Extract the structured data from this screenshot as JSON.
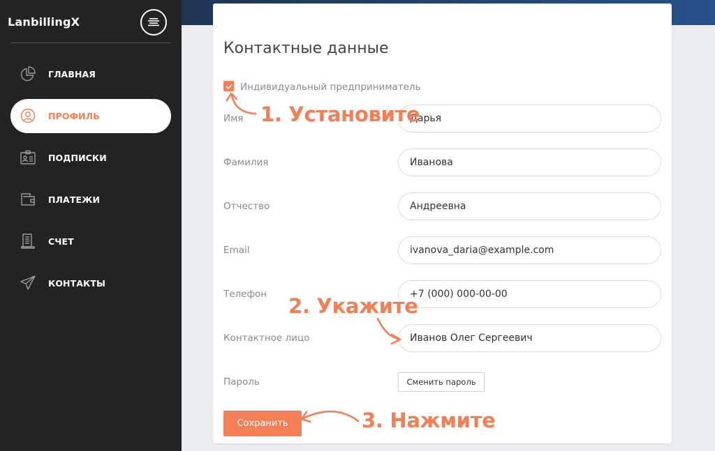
{
  "app": {
    "brand": "LanbillingX"
  },
  "sidebar": {
    "items": [
      {
        "label": "ГЛАВНАЯ",
        "icon": "pie-chart-icon",
        "active": false
      },
      {
        "label": "ПРОФИЛЬ",
        "icon": "user-circle-icon",
        "active": true
      },
      {
        "label": "ПОДПИСКИ",
        "icon": "id-card-icon",
        "active": false
      },
      {
        "label": "ПЛАТЕЖИ",
        "icon": "wallet-icon",
        "active": false
      },
      {
        "label": "СЧЕТ",
        "icon": "receipt-icon",
        "active": false
      },
      {
        "label": "КОНТАКТЫ",
        "icon": "paper-plane-icon",
        "active": false
      }
    ]
  },
  "form": {
    "title": "Контактные данные",
    "entrepreneur": {
      "label": "Индивидуальный предприниматель",
      "checked": true
    },
    "fields": {
      "first_name": {
        "label": "Имя",
        "value": "Дарья"
      },
      "last_name": {
        "label": "Фамилия",
        "value": "Иванова"
      },
      "middle_name": {
        "label": "Отчество",
        "value": "Андреевна"
      },
      "email": {
        "label": "Email",
        "value": "ivanova_daria@example.com"
      },
      "phone": {
        "label": "Телефон",
        "value": "+7 (000) 000-00-00"
      },
      "contact_person": {
        "label": "Контактное лицо",
        "value": "Иванов Олег Сергеевич"
      },
      "password": {
        "label": "Пароль"
      }
    },
    "change_password_label": "Сменить пароль",
    "save_label": "Сохранить"
  },
  "annotations": {
    "step1": "1. Установите",
    "step2": "2. Укажите",
    "step3": "3. Нажмите"
  },
  "colors": {
    "accent": "#f47e55",
    "sidebar_bg": "#232323",
    "page_bg": "#ebecf0"
  }
}
